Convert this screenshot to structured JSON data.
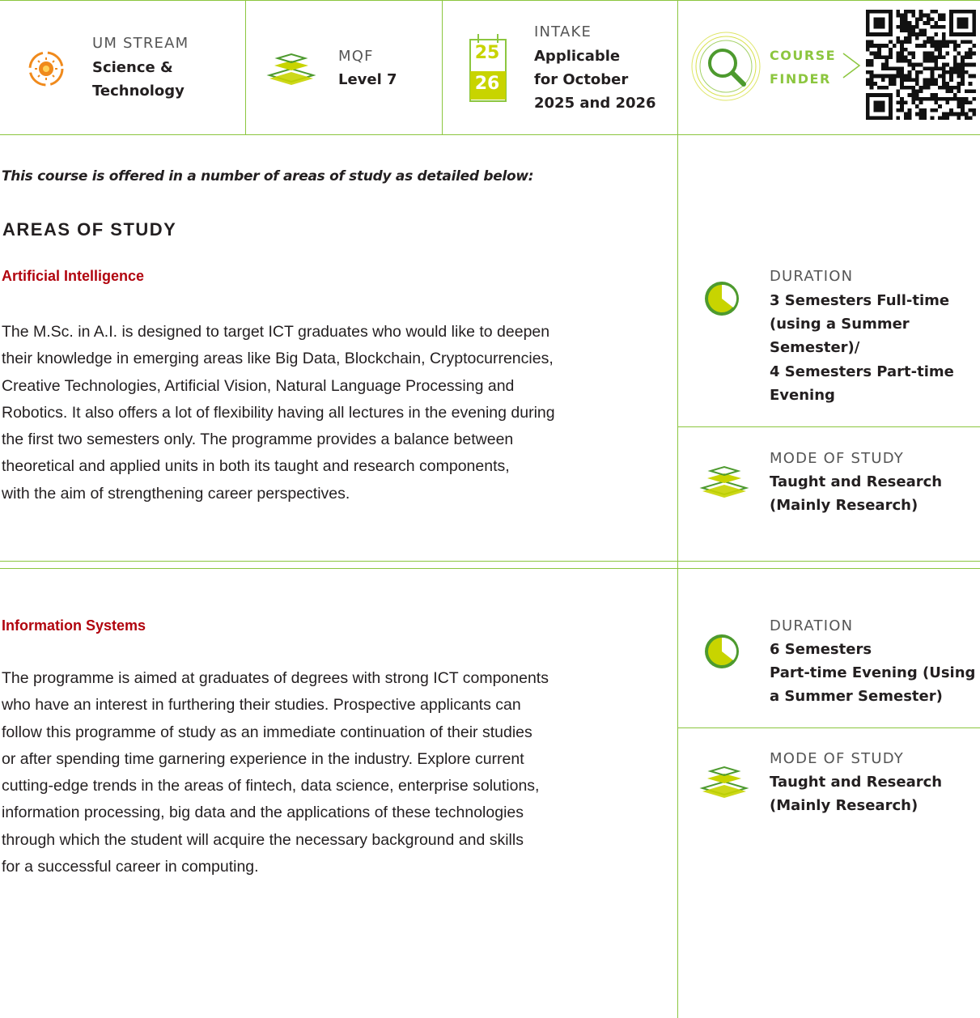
{
  "header": {
    "stream": {
      "label": "UM STREAM",
      "value_lines": [
        "Science &",
        "Technology"
      ],
      "icon": "atom-sun-icon"
    },
    "mqf": {
      "label": "MQF",
      "value": "Level 7",
      "icon": "stacked-layers-icon"
    },
    "intake": {
      "label": "INTAKE",
      "value_lines": [
        "Applicable",
        "for October",
        "2025 and 2026"
      ],
      "cal_top": "25",
      "cal_bottom": "26",
      "icon": "calendar-icon"
    },
    "course_finder": {
      "line1": "COURSE",
      "line2": "FINDER",
      "icon": "magnifier-icon",
      "qr": "qr-code-icon"
    }
  },
  "intro": "This course is offered in a number of areas of study as detailed below:",
  "areas_heading": "AREAS OF STUDY",
  "areas": [
    {
      "title": "Artificial Intelligence",
      "paragraph_lines": [
        "The M.Sc. in A.I. is designed to target ICT graduates who would like to deepen",
        "their knowledge in emerging areas like Big Data, Blockchain, Cryptocurrencies,",
        "Creative Technologies, Artificial Vision, Natural Language Processing and",
        "Robotics. It also offers a lot of flexibility having all lectures in the evening during",
        "the first two semesters only. The programme provides a balance between",
        "theoretical and applied units in both its taught and research components,",
        "with the aim of strengthening career perspectives."
      ],
      "duration_label": "DURATION",
      "duration_lines": [
        "3 Semesters Full-time",
        "(using a Summer",
        "Semester)/",
        "4 Semesters Part-time",
        "Evening"
      ],
      "mode_label": "MODE OF STUDY",
      "mode_lines": [
        "Taught and Research",
        "(Mainly Research)"
      ]
    },
    {
      "title": "Information Systems",
      "paragraph_lines": [
        "The programme is aimed at graduates of degrees with strong ICT components",
        "who have an interest in furthering their studies. Prospective applicants can",
        "follow this programme of study as an immediate continuation of their studies",
        "or after spending time garnering experience in the industry. Explore current",
        "cutting-edge trends in the areas of fintech, data science, enterprise solutions,",
        "information processing, big data and the applications of these technologies",
        "through which the student will acquire the necessary background and skills",
        "for a successful career in computing."
      ],
      "duration_label": "DURATION",
      "duration_lines": [
        "6 Semesters",
        "Part-time Evening (Using",
        "a Summer Semester)"
      ],
      "mode_label": "MODE OF STUDY",
      "mode_lines": [
        "Taught and Research",
        "(Mainly Research)"
      ]
    }
  ],
  "colors": {
    "accent_green": "#8cc63f",
    "lime": "#c8d400",
    "dark_green": "#4d9a2e",
    "orange": "#f08a1c",
    "heading_red": "#b1040e"
  }
}
